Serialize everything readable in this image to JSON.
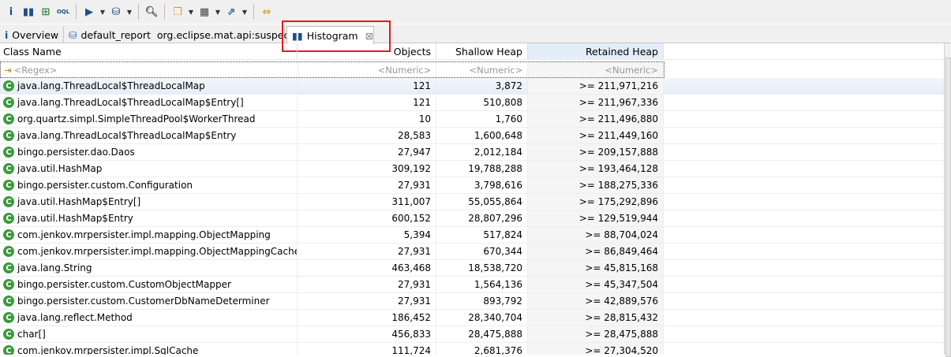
{
  "toolbar": {
    "icons": [
      "info-icon",
      "histogram-icon",
      "dominator-tree-icon",
      "oql-icon",
      "run-report-icon",
      "query-browser-icon",
      "search-icon",
      "group-icon",
      "calculator-icon",
      "export-icon",
      "compare-icon"
    ],
    "oql_label": "OQL"
  },
  "tabs": [
    {
      "label": "Overview",
      "icon": "info-icon"
    },
    {
      "label": "default_report  org.eclipse.mat.api:suspects",
      "icon": "report-icon"
    },
    {
      "label": "Histogram",
      "icon": "histogram-icon",
      "active": true
    }
  ],
  "columns": [
    "Class Name",
    "Objects",
    "Shallow Heap",
    "Retained Heap"
  ],
  "filter": {
    "name": "<Regex>",
    "objects": "<Numeric>",
    "shallow": "<Numeric>",
    "retained": "<Numeric>"
  },
  "rows": [
    {
      "name": "java.lang.ThreadLocal$ThreadLocalMap",
      "objects": "121",
      "shallow": "3,872",
      "retained": ">= 211,971,216"
    },
    {
      "name": "java.lang.ThreadLocal$ThreadLocalMap$Entry[]",
      "objects": "121",
      "shallow": "510,808",
      "retained": ">= 211,967,336"
    },
    {
      "name": "org.quartz.simpl.SimpleThreadPool$WorkerThread",
      "objects": "10",
      "shallow": "1,760",
      "retained": ">= 211,496,880"
    },
    {
      "name": "java.lang.ThreadLocal$ThreadLocalMap$Entry",
      "objects": "28,583",
      "shallow": "1,600,648",
      "retained": ">= 211,449,160"
    },
    {
      "name": "bingo.persister.dao.Daos",
      "objects": "27,947",
      "shallow": "2,012,184",
      "retained": ">= 209,157,888"
    },
    {
      "name": "java.util.HashMap",
      "objects": "309,192",
      "shallow": "19,788,288",
      "retained": ">= 193,464,128"
    },
    {
      "name": "bingo.persister.custom.Configuration",
      "objects": "27,931",
      "shallow": "3,798,616",
      "retained": ">= 188,275,336"
    },
    {
      "name": "java.util.HashMap$Entry[]",
      "objects": "311,007",
      "shallow": "55,055,864",
      "retained": ">= 175,292,896"
    },
    {
      "name": "java.util.HashMap$Entry",
      "objects": "600,152",
      "shallow": "28,807,296",
      "retained": ">= 129,519,944"
    },
    {
      "name": "com.jenkov.mrpersister.impl.mapping.ObjectMapping",
      "objects": "5,394",
      "shallow": "517,824",
      "retained": ">= 88,704,024"
    },
    {
      "name": "com.jenkov.mrpersister.impl.mapping.ObjectMappingCache",
      "objects": "27,931",
      "shallow": "670,344",
      "retained": ">= 86,849,464"
    },
    {
      "name": "java.lang.String",
      "objects": "463,468",
      "shallow": "18,538,720",
      "retained": ">= 45,815,168"
    },
    {
      "name": "bingo.persister.custom.CustomObjectMapper",
      "objects": "27,931",
      "shallow": "1,564,136",
      "retained": ">= 45,347,504"
    },
    {
      "name": "bingo.persister.custom.CustomerDbNameDeterminer",
      "objects": "27,931",
      "shallow": "893,792",
      "retained": ">= 42,889,576"
    },
    {
      "name": "java.lang.reflect.Method",
      "objects": "186,452",
      "shallow": "28,340,704",
      "retained": ">= 28,815,432"
    },
    {
      "name": "char[]",
      "objects": "456,833",
      "shallow": "28,475,888",
      "retained": ">= 28,475,888"
    },
    {
      "name": "com.jenkov.mrpersister.impl.SqlCache",
      "objects": "111,724",
      "shallow": "2,681,376",
      "retained": ">= 27,304,520"
    }
  ],
  "class_icon_letter": "C",
  "colors": {
    "highlight": "#e41b1b",
    "class_icon": "#3c9a3c"
  }
}
